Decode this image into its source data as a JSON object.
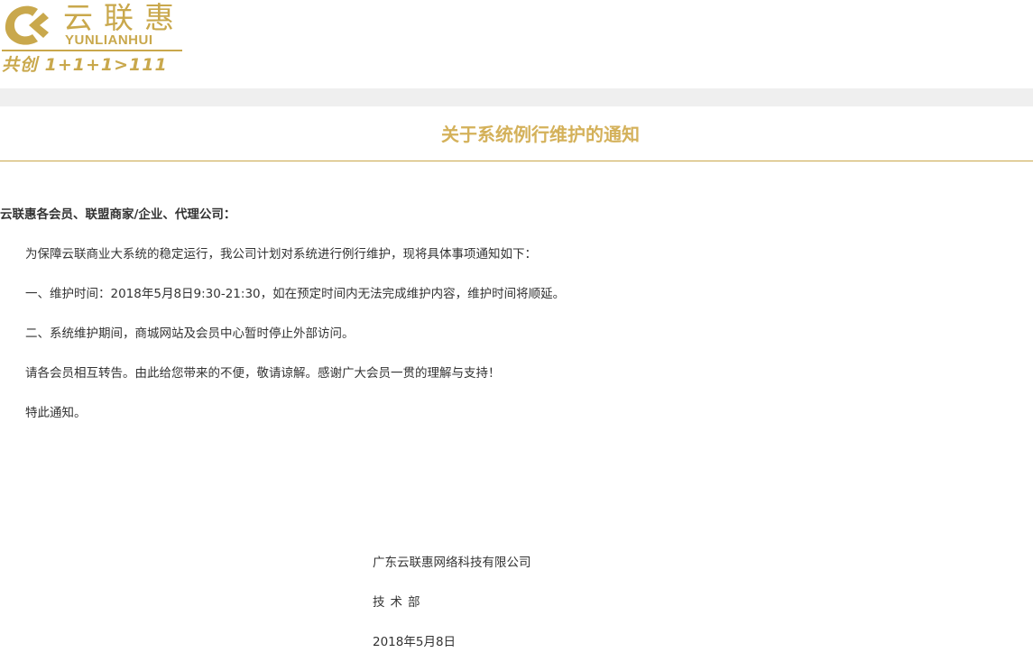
{
  "brand": {
    "name_cn": "云联惠",
    "name_en": "YUNLIANHUI",
    "slogan": "共创 1+1+1>111",
    "color": "#c9a84c"
  },
  "notice": {
    "title": "关于系统例行维护的通知",
    "salutation": "云联惠各会员、联盟商家/企业、代理公司：",
    "paragraphs": [
      "为保障云联商业大系统的稳定运行，我公司计划对系统进行例行维护，现将具体事项通知如下：",
      "一、维护时间：2018年5月8日9:30-21:30，如在预定时间内无法完成维护内容，维护时间将顺延。",
      "二、系统维护期间，商城网站及会员中心暂时停止外部访问。",
      "请各会员相互转告。由此给您带来的不便，敬请谅解。感谢广大会员一贯的理解与支持！",
      "特此通知。"
    ],
    "signature": {
      "company": "广东云联惠网络科技有限公司",
      "department": "技术部",
      "date": "2018年5月8日"
    }
  }
}
